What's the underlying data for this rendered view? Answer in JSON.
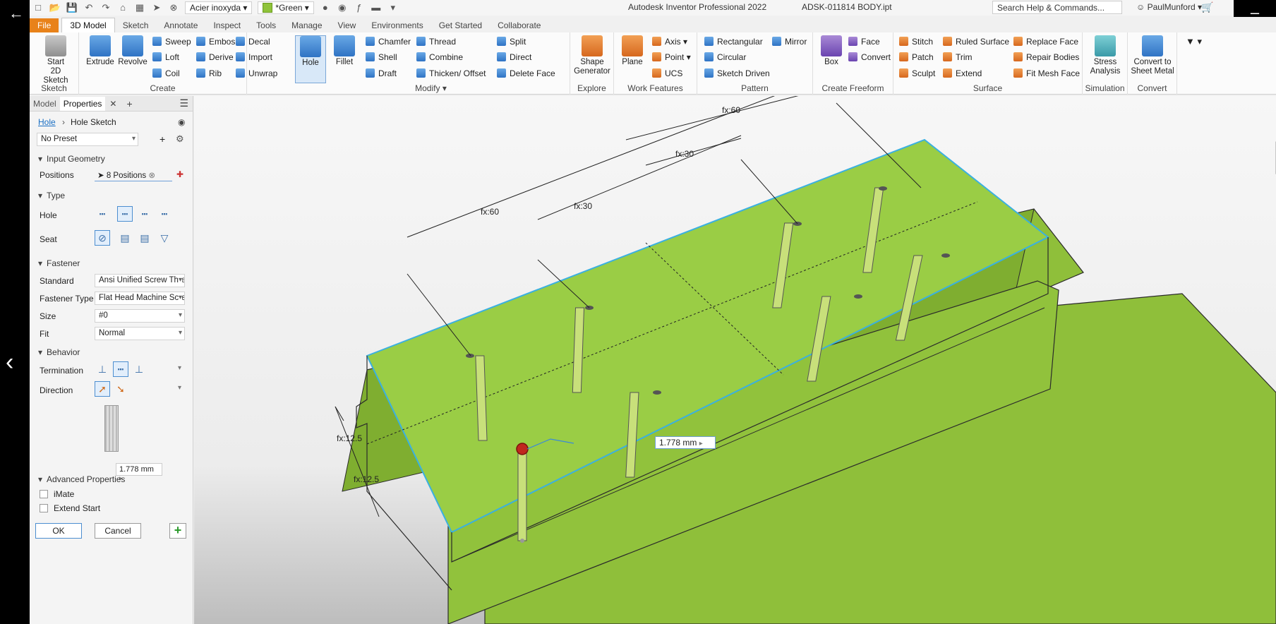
{
  "window": {
    "title": "Autodesk Inventor Professional 2022",
    "file_name": "ADSK-011814 BODY.ipt",
    "material": "Acier inoxyda",
    "appearance": "*Green",
    "search_placeholder": "Search Help & Commands...",
    "user": "PaulMunford"
  },
  "tabs": [
    "File",
    "3D Model",
    "Sketch",
    "Annotate",
    "Inspect",
    "Tools",
    "Manage",
    "View",
    "Environments",
    "Get Started",
    "Collaborate"
  ],
  "active_tab": "3D Model",
  "ribbon": {
    "sketch": {
      "label": "Sketch",
      "start_2d_sketch": "Start\n2D Sketch"
    },
    "create": {
      "label": "Create",
      "extrude": "Extrude",
      "revolve": "Revolve",
      "sweep": "Sweep",
      "loft": "Loft",
      "coil": "Coil",
      "emboss": "Emboss",
      "derive": "Derive",
      "rib": "Rib",
      "decal": "Decal",
      "import": "Import",
      "unwrap": "Unwrap"
    },
    "modify": {
      "label": "Modify",
      "hole": "Hole",
      "fillet": "Fillet",
      "chamfer": "Chamfer",
      "shell": "Shell",
      "draft": "Draft",
      "thread": "Thread",
      "combine": "Combine",
      "thicken_offset": "Thicken/ Offset",
      "split": "Split",
      "direct": "Direct",
      "delete_face": "Delete Face"
    },
    "explore": {
      "label": "Explore",
      "shape_generator": "Shape\nGenerator"
    },
    "work_features": {
      "label": "Work Features",
      "plane": "Plane",
      "axis": "Axis",
      "point": "Point",
      "ucs": "UCS"
    },
    "pattern": {
      "label": "Pattern",
      "rectangular": "Rectangular",
      "circular": "Circular",
      "sketch_driven": "Sketch Driven",
      "mirror": "Mirror"
    },
    "create_freeform": {
      "label": "Create Freeform",
      "box": "Box",
      "face": "Face",
      "convert": "Convert"
    },
    "surface": {
      "label": "Surface",
      "stitch": "Stitch",
      "patch": "Patch",
      "sculpt": "Sculpt",
      "ruled_surface": "Ruled Surface",
      "trim": "Trim",
      "extend": "Extend",
      "replace_face": "Replace Face",
      "repair_bodies": "Repair Bodies",
      "fit_mesh_face": "Fit Mesh Face"
    },
    "simulation": {
      "label": "Simulation",
      "stress_analysis": "Stress\nAnalysis"
    },
    "convert": {
      "label": "Convert",
      "convert_to_sheet_metal": "Convert to\nSheet Metal"
    }
  },
  "panel": {
    "tab_model": "Model",
    "tab_properties": "Properties",
    "breadcrumb_root": "Hole",
    "breadcrumb_child": "Hole Sketch",
    "preset": "No Preset",
    "input_geometry": "Input Geometry",
    "positions_label": "Positions",
    "positions_value": "8 Positions",
    "type_section": "Type",
    "hole_label": "Hole",
    "seat_label": "Seat",
    "fastener_section": "Fastener",
    "standard_label": "Standard",
    "standard_value": "Ansi Unified Screw Thre",
    "fastener_type_label": "Fastener Type",
    "fastener_type_value": "Flat Head Machine Scre",
    "size_label": "Size",
    "size_value": "#0",
    "fit_label": "Fit",
    "fit_value": "Normal",
    "behavior_section": "Behavior",
    "termination_label": "Termination",
    "direction_label": "Direction",
    "diameter_value": "1.778 mm",
    "advanced_section": "Advanced Properties",
    "imate_label": "iMate",
    "extend_start_label": "Extend Start",
    "ok_label": "OK",
    "cancel_label": "Cancel"
  },
  "viewport": {
    "dim_top_total": "fx:60",
    "dim_top_half": "fx:30",
    "dim_left_total": "fx:60",
    "dim_left_half": "fx:30",
    "dim_edge_1": "fx:12.5",
    "dim_edge_2": "fx:12.5",
    "diameter_input": "1.778 mm",
    "body_color": "#9acd45",
    "edge_highlight": "#3ab0e0"
  }
}
